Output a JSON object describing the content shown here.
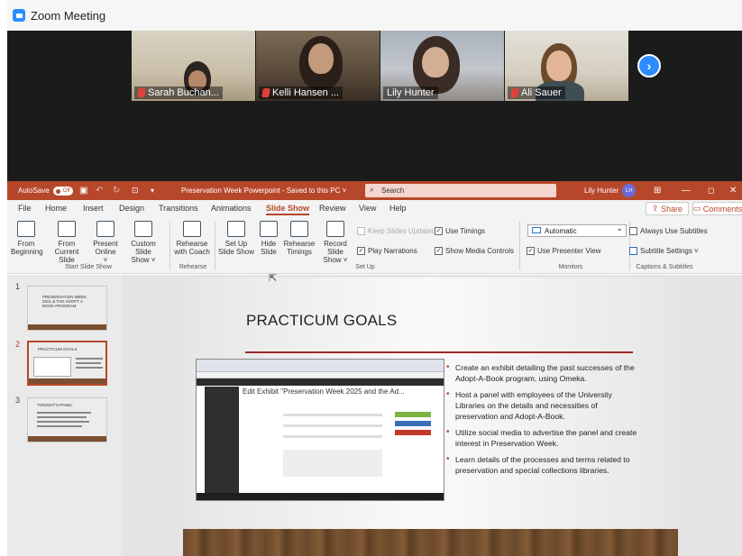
{
  "zoom": {
    "title": "Zoom Meeting",
    "participants": [
      {
        "name": "Sarah Buchan...",
        "muted": true
      },
      {
        "name": "Kelli Hansen ...",
        "muted": true
      },
      {
        "name": "Lily Hunter",
        "muted": false,
        "active": true
      },
      {
        "name": "Ali Sauer",
        "muted": true
      }
    ],
    "next_icon": "chevron-right-icon"
  },
  "ppt": {
    "autosave_label": "AutoSave",
    "autosave_state": "Off",
    "doc_title": "Preservation Week Powerpoint - Saved to this PC",
    "search_placeholder": "Search",
    "user_name": "Lily Hunter",
    "user_initials": "LH",
    "window_controls": [
      "—",
      "◻",
      "✕"
    ],
    "tabs": [
      "File",
      "Home",
      "Insert",
      "Design",
      "Transitions",
      "Animations",
      "Slide Show",
      "Review",
      "View",
      "Help"
    ],
    "active_tab": "Slide Show",
    "share_label": "Share",
    "comments_label": "Comments",
    "ribbon": {
      "start_group": "Start Slide Show",
      "rehearse_group": "Rehearse",
      "setup_group": "Set Up",
      "monitors_group": "Monitors",
      "captions_group": "Captions & Subtitles",
      "buttons": {
        "from_beginning": [
          "From",
          "Beginning"
        ],
        "from_current": [
          "From",
          "Current Slide"
        ],
        "present_online": [
          "Present",
          "Online ˅"
        ],
        "custom_show": [
          "Custom Slide",
          "Show ˅"
        ],
        "rehearse_coach": [
          "Rehearse",
          "with Coach"
        ],
        "setup_show": [
          "Set Up",
          "Slide Show"
        ],
        "hide_slide": [
          "Hide",
          "Slide"
        ],
        "rehearse_timings": [
          "Rehearse",
          "Timings"
        ],
        "record_show": [
          "Record Slide",
          "Show ˅"
        ]
      },
      "checks": {
        "keep_updated": "Keep Slides Updated",
        "use_timings": "Use Timings",
        "play_narrations": "Play Narrations",
        "show_media": "Show Media Controls",
        "presenter_view": "Use Presenter View",
        "always_subtitles": "Always Use Subtitles",
        "subtitle_settings": "Subtitle Settings ˅"
      },
      "monitor_value": "Automatic"
    }
  },
  "thumbnails": [
    {
      "num": "1",
      "text": "PRESERVATION WEEK 2021 & THE ADOPT A BOOK PROGRAM"
    },
    {
      "num": "2",
      "text": "PRACTICUM GOALS"
    },
    {
      "num": "3",
      "text": "TONIGHT'S PANEL"
    }
  ],
  "slide": {
    "title": "PRACTICUM GOALS",
    "embedded_heading": "Edit Exhibit \"Preservation Week 2025 and the Ad...",
    "bullets": [
      "Create an exhibit detailing the past successes of the Adopt-A-Book program, using Omeka.",
      "Host a panel with employees of the University Libraries on the details and necessities of preservation and Adopt-A-Book.",
      "Utilize social media to advertise the panel and create interest in Preservation Week.",
      "Learn details of the processes and terms related to preservation and special collections libraries."
    ]
  },
  "colors": {
    "ppt_accent": "#b7472a",
    "zoom_blue": "#2d8cff",
    "active_speaker": "#9ed34b"
  }
}
